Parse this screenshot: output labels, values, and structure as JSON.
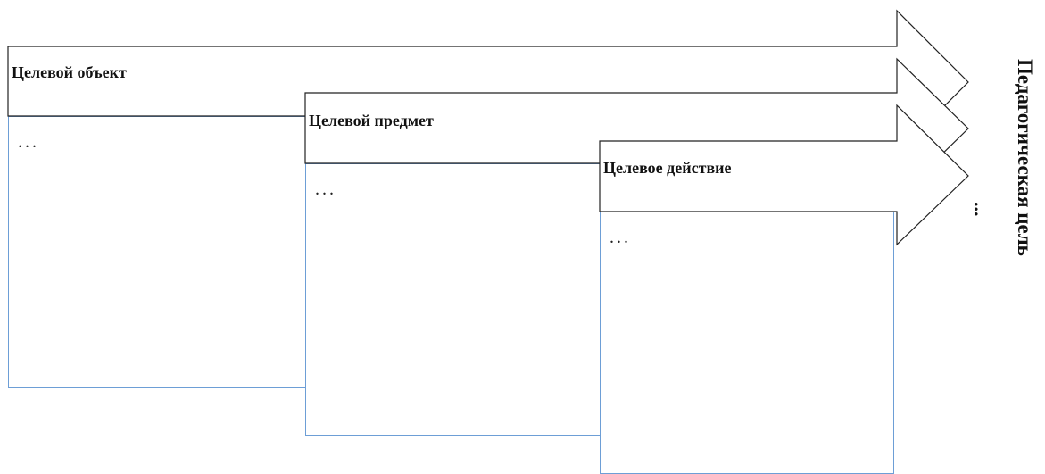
{
  "diagram": {
    "stages": [
      {
        "title": "Целевой объект",
        "content": "..."
      },
      {
        "title": "Целевой предмет",
        "content": "..."
      },
      {
        "title": "Целевое действие",
        "content": "..."
      }
    ],
    "goal_label": "Педагогическая цель",
    "continuation_label": "..."
  }
}
